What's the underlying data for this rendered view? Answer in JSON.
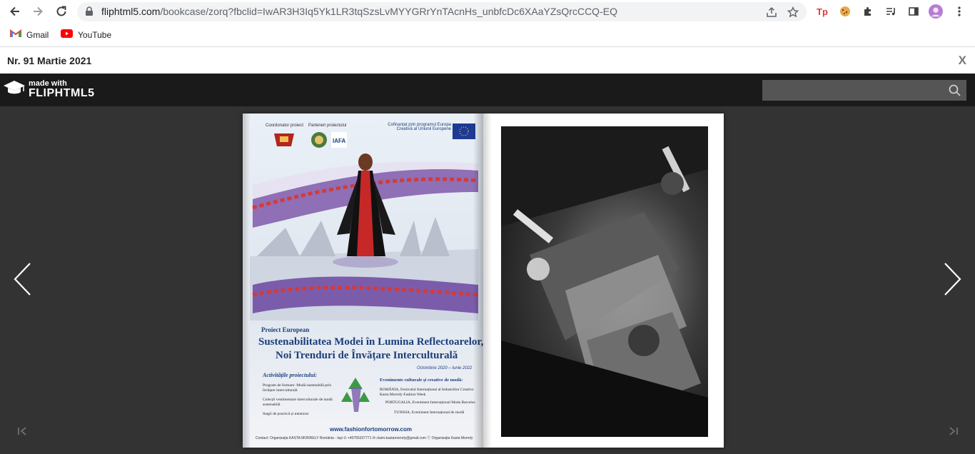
{
  "browser": {
    "url_host": "fliphtml5.com",
    "url_path": "/bookcase/zorq?fbclid=IwAR3H3Iq5Yk1LR3tqSzsLvMYYGRrYnTAcnHs_unbfcDc6XAaYZsQrcCCQ-EQ",
    "bookmarks": [
      {
        "label": "Gmail",
        "icon": "gmail-icon"
      },
      {
        "label": "YouTube",
        "icon": "youtube-icon"
      }
    ],
    "extension_tp_label": "Tp"
  },
  "page": {
    "title": "Nr. 91 Martie 2021",
    "close_label": "X"
  },
  "viewer": {
    "logo_small": "made with",
    "logo_big": "FLIPHTML5",
    "search_placeholder": ""
  },
  "poster": {
    "coordinator_label": "Coordonator proiect",
    "partners_label": "Parteneri proiectului",
    "cofunded": "Cofinanțat prin programul Europa Creativă al Uniunii Europene",
    "kicker": "Proiect European",
    "line1": "Sustenabilitatea Modei în Lumina Reflectoarelor,",
    "line2": "Noi Trenduri de Învățare Interculturală",
    "dates": "Octombrie 2020 – Iunie 2022",
    "activities_title": "Activitățile proiectului:",
    "activities_left": [
      "Program de formare: Modă sustenabilă prin învățare interculturală",
      "Colecții vestimentare interculturale de modă sustenabilă",
      "Stagii de practică și mentorat"
    ],
    "events_title": "Evenimente culturale și creative de modă:",
    "events_right": [
      "ROMÂNIA, Festivalul Internațional al Industriilor Creative Kasta Morrely Fashion Week",
      "PORTUGALIA, Eveniment Internațional Moda Barcelos",
      "TUNISIA, Eveniment Internațional de modă"
    ],
    "website": "www.fashionfortomorrow.com",
    "contact": "Contact: Organizația KASTA MORRELY România - Iași ✆ +40755327771 ✉ claim.kastamorrely@gmail.com ⓕ Organizația Kasta Morrely"
  }
}
